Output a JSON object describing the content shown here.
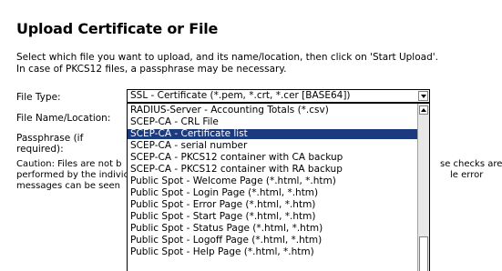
{
  "page": {
    "title": "Upload Certificate or File",
    "intro_line1": "Select which file you want to upload, and its name/location, then click on 'Start Upload'.",
    "intro_line2": "In case of PKCS12 files, a passphrase may be necessary."
  },
  "form": {
    "file_type_label": "File Type:",
    "file_name_label": "File Name/Location:",
    "passphrase_label_line1": "Passphrase (if",
    "passphrase_label_line2": "required):",
    "selected_file_type": "SSL - Certificate (*.pem, *.crt, *.cer [BASE64])"
  },
  "caution": {
    "line1_left": "Caution: Files are not b",
    "line1_right": "se checks are",
    "line2_left": "performed by the indivic",
    "line2_right": "le error",
    "line3_left": "messages can be seen"
  },
  "dropdown": {
    "options": [
      "RADIUS-Server - Accounting Totals (*.csv)",
      "SCEP-CA - CRL File",
      "SCEP-CA - Certificate list",
      "SCEP-CA - serial number",
      "SCEP-CA - PKCS12 container with CA backup",
      "SCEP-CA - PKCS12 container with RA backup",
      "Public Spot - Welcome Page (*.html, *.htm)",
      "Public Spot - Login Page (*.html, *.htm)",
      "Public Spot - Error Page (*.html, *.htm)",
      "Public Spot - Start Page (*.html, *.htm)",
      "Public Spot - Status Page (*.html, *.htm)",
      "Public Spot - Logoff Page (*.html, *.htm)",
      "Public Spot - Help Page (*.html, *.htm)"
    ],
    "highlighted": "SCEP-CA - Certificate list"
  },
  "colors": {
    "highlight": "#1c3a7e"
  }
}
